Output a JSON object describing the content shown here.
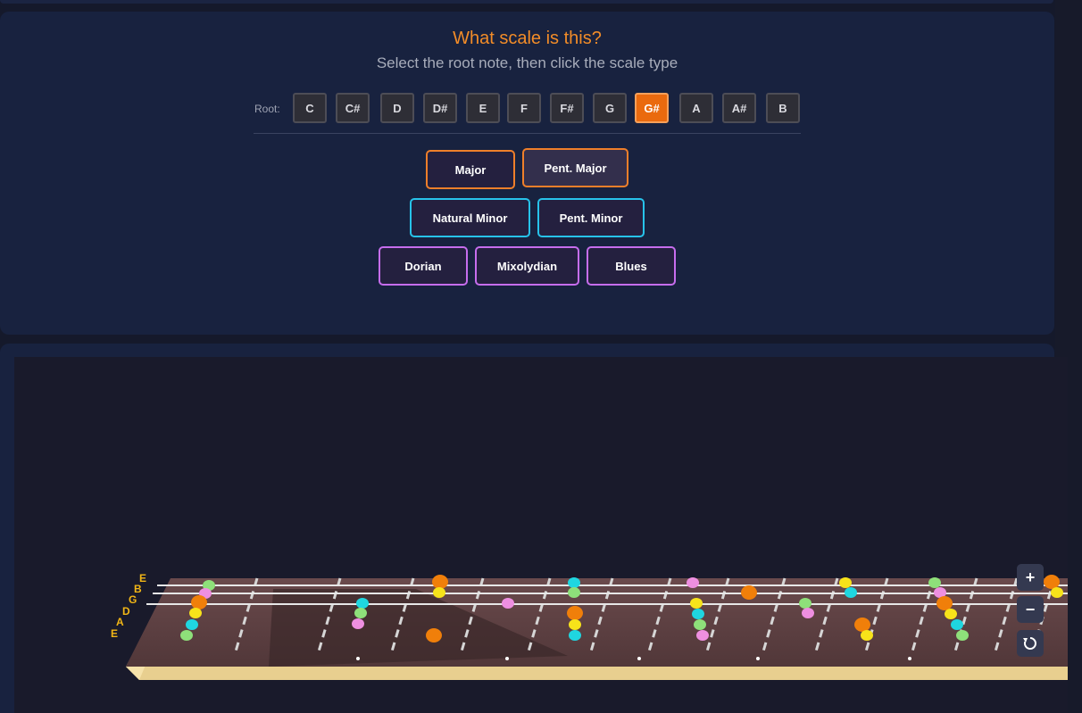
{
  "quiz": {
    "question": "What scale is this?",
    "instruction": "Select the root note, then click the scale type",
    "root_label": "Root:",
    "roots": [
      "C",
      "C#",
      "D",
      "D#",
      "E",
      "F",
      "F#",
      "G",
      "G#",
      "A",
      "A#",
      "B"
    ],
    "selected_root": "G#",
    "scale_types": [
      {
        "label": "Major",
        "group": "major"
      },
      {
        "label": "Pent. Major",
        "group": "major"
      },
      {
        "label": "Natural Minor",
        "group": "minor"
      },
      {
        "label": "Pent. Minor",
        "group": "minor"
      },
      {
        "label": "Dorian",
        "group": "mode"
      },
      {
        "label": "Mixolydian",
        "group": "mode"
      },
      {
        "label": "Blues",
        "group": "mode"
      }
    ]
  },
  "fretboard": {
    "string_labels": [
      "E",
      "B",
      "G",
      "D",
      "A",
      "E"
    ],
    "zoom_in": "+",
    "zoom_out": "−",
    "reset_icon": "rotate-reset-icon"
  },
  "colors": {
    "accent": "#ea6a0e",
    "title": "#f28c28",
    "major_border": "#ef7f2a",
    "minor_border": "#27c3ea",
    "mode_border": "#c66ded",
    "string_gold": "#f2b616"
  }
}
